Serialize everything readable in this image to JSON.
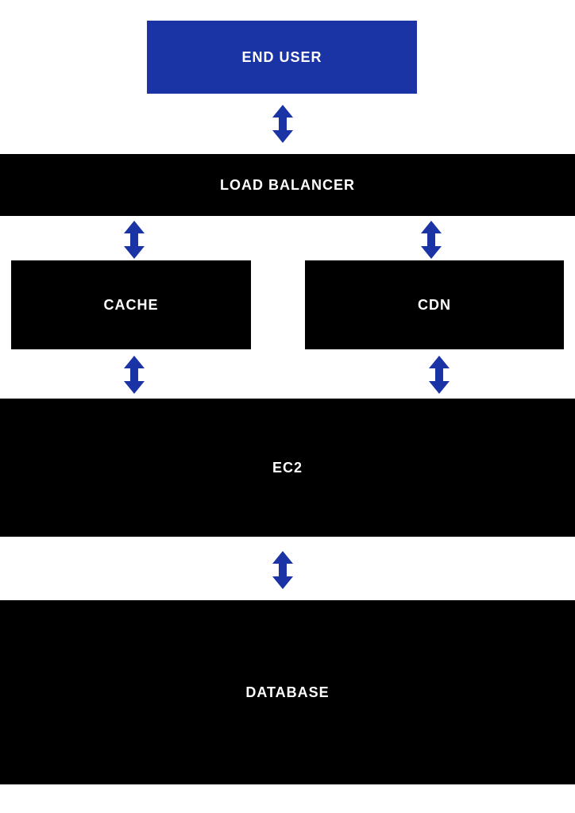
{
  "nodes": {
    "end_user": "END USER",
    "load_balancer": "LOAD BALANCER",
    "cache": "CACHE",
    "cdn": "CDN",
    "ec2": "EC2",
    "database": "DATABASE"
  },
  "colors": {
    "primary_blue": "#1a33a5",
    "black": "#000000",
    "arrow": "#1a33a5"
  },
  "connections": [
    {
      "from": "end_user",
      "to": "load_balancer",
      "bidirectional": true
    },
    {
      "from": "load_balancer",
      "to": "cache",
      "bidirectional": true
    },
    {
      "from": "load_balancer",
      "to": "cdn",
      "bidirectional": true
    },
    {
      "from": "cache",
      "to": "ec2",
      "bidirectional": true
    },
    {
      "from": "cdn",
      "to": "ec2",
      "bidirectional": true
    },
    {
      "from": "ec2",
      "to": "database",
      "bidirectional": true
    }
  ]
}
